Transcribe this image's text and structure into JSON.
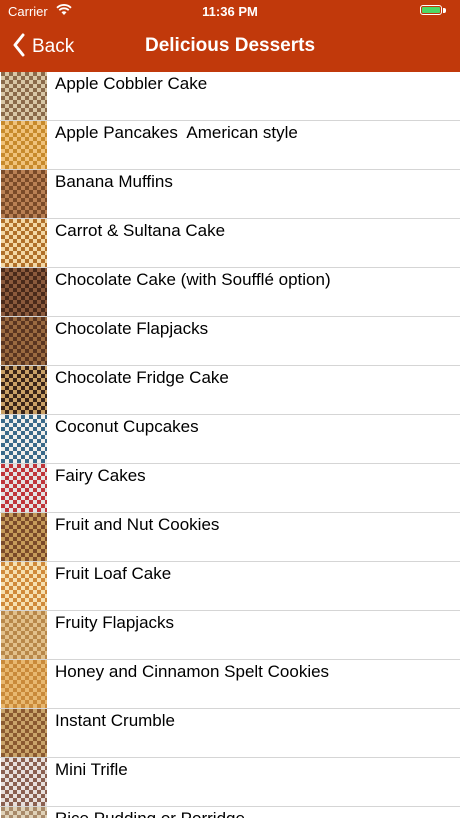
{
  "status_bar": {
    "carrier": "Carrier",
    "time": "11:36 PM"
  },
  "nav": {
    "back_label": "Back",
    "title": "Delicious Desserts"
  },
  "recipes": [
    {
      "name": "Apple Cobbler Cake",
      "thumb_colors": [
        "#8a6a4a",
        "#d8c7a6"
      ]
    },
    {
      "name": "Apple Pancakes  American style",
      "thumb_colors": [
        "#c78a2c",
        "#f0c27a"
      ]
    },
    {
      "name": "Banana Muffins",
      "thumb_colors": [
        "#7a4a28",
        "#b98054"
      ]
    },
    {
      "name": "Carrot & Sultana Cake",
      "thumb_colors": [
        "#b0702a",
        "#f3d8a5"
      ]
    },
    {
      "name": "Chocolate Cake (with Soufflé option)",
      "thumb_colors": [
        "#4a2a1a",
        "#8b5a3c"
      ]
    },
    {
      "name": "Chocolate Flapjacks",
      "thumb_colors": [
        "#5a3520",
        "#9a6a40"
      ]
    },
    {
      "name": "Chocolate Fridge Cake",
      "thumb_colors": [
        "#3a2418",
        "#c9a066"
      ]
    },
    {
      "name": "Coconut Cupcakes",
      "thumb_colors": [
        "#f2f0ec",
        "#3a6a8a"
      ]
    },
    {
      "name": "Fairy Cakes",
      "thumb_colors": [
        "#c0353a",
        "#e3e3e3"
      ]
    },
    {
      "name": "Fruit and Nut Cookies",
      "thumb_colors": [
        "#c59a5a",
        "#7a4a2a"
      ]
    },
    {
      "name": "Fruit Loaf Cake",
      "thumb_colors": [
        "#d08a3a",
        "#f6e0b0"
      ]
    },
    {
      "name": "Fruity Flapjacks",
      "thumb_colors": [
        "#b8884a",
        "#e2c08a"
      ]
    },
    {
      "name": "Honey and Cinnamon Spelt Cookies",
      "thumb_colors": [
        "#c98a3a",
        "#e8b870"
      ]
    },
    {
      "name": "Instant Crumble",
      "thumb_colors": [
        "#c9a46a",
        "#8a5a30"
      ]
    },
    {
      "name": "Mini Trifle",
      "thumb_colors": [
        "#e8e0dc",
        "#8a6050"
      ]
    },
    {
      "name": "Rice Pudding or Porridge",
      "thumb_colors": [
        "#a88a6a",
        "#e0d2b8"
      ]
    }
  ],
  "colors": {
    "nav_bar": "#c1390b",
    "battery": "#4cd964"
  }
}
